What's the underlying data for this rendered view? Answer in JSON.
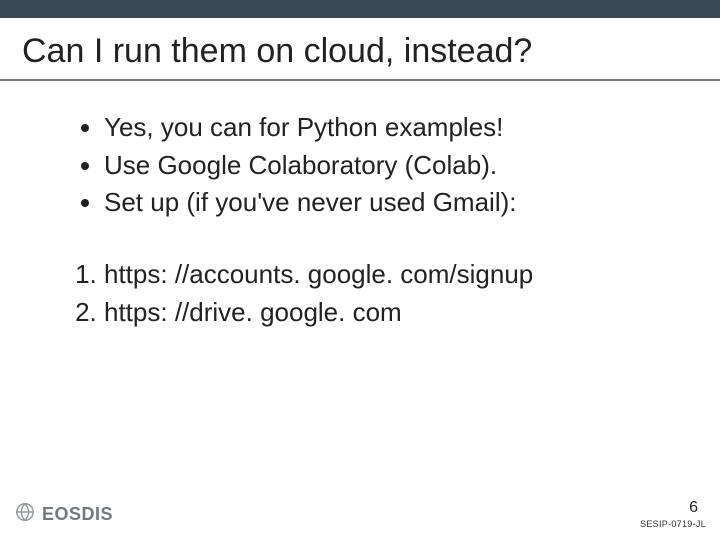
{
  "title": "Can I run them on cloud, instead?",
  "bullets": [
    "Yes, you can for Python examples!",
    "Use Google Colaboratory (Colab).",
    "Set up (if you've never used Gmail):"
  ],
  "numbered": [
    "https: //accounts. google. com/signup",
    "https: //drive. google. com"
  ],
  "footer": {
    "logo_text": "EOSDIS",
    "page_number": "6",
    "doc_id": "SESIP-0719-JL"
  }
}
